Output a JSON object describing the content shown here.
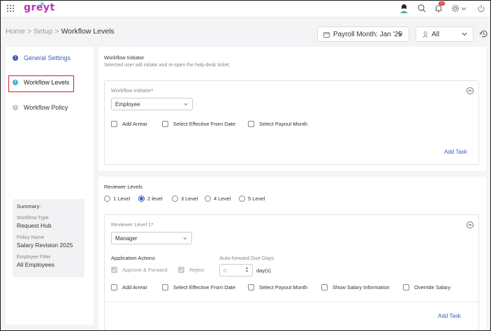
{
  "app": {
    "logo_text": "greyt",
    "notification_count": "10"
  },
  "icons": {
    "apps": "apps-grid-icon",
    "search": "search-icon",
    "bell": "bell-icon",
    "settings": "gear-icon",
    "power": "power-icon",
    "calendar": "calendar-icon",
    "user": "user-icon",
    "history": "history-icon",
    "collapse": "chevron-up-icon"
  },
  "colors": {
    "brand": "#c02dbf",
    "accent": "#3d5bbd",
    "step_active": "#45b0c9",
    "highlight": "#d21f26",
    "required": "#e53935"
  },
  "breadcrumb": {
    "home": "Home",
    "sep1": ">",
    "setup": "Setup",
    "sep2": ">",
    "current": "Workflow Levels"
  },
  "header": {
    "payroll_month": "Payroll Month: Jan '25",
    "filter_all": "All"
  },
  "steps": [
    {
      "num": "1",
      "label": "General Settings"
    },
    {
      "num": "2",
      "label": "Workflow Levels"
    },
    {
      "num": "3",
      "label": "Workflow Policy"
    }
  ],
  "summary": {
    "title": "Summary:",
    "workflow_type_label": "Workflow Type",
    "workflow_type": "Request Hub",
    "policy_name_label": "Policy Name",
    "policy_name": "Salary Revision 2025",
    "employee_filter_label": "Employee Filter",
    "employee_filter": "All Employees"
  },
  "initiator": {
    "title": "Workflow Initiator",
    "subtitle": "Selected user will initiate and re-open the help-desk ticket.",
    "field_label": "Workflow Initiator",
    "required_mark": "*",
    "selected": "Employee",
    "options": [
      "Add Arrear",
      "Select Effective From Date",
      "Select Payout Month"
    ],
    "add_task": "Add Task"
  },
  "reviewer": {
    "title": "Reviewer Levels",
    "levels": [
      "1 Level",
      "2 level",
      "3 Level",
      "4 Level",
      "5 Level"
    ],
    "selected_level": "2 level",
    "level1_label": "Reviewer Level 1",
    "required_mark": "*",
    "level1_selected": "Manager",
    "actions_label": "Application Actions",
    "approve_forward": "Approve & Forward",
    "reject": "Reject",
    "auto_forward_label": "Auto-forward Due Days",
    "due_days_placeholder": "0",
    "days_suffix": "day(s)",
    "options": [
      "Add Arrear",
      "Select Effective From Date",
      "Select Payout Month",
      "Show Salary Information",
      "Override Salary"
    ],
    "add_task": "Add Task"
  }
}
